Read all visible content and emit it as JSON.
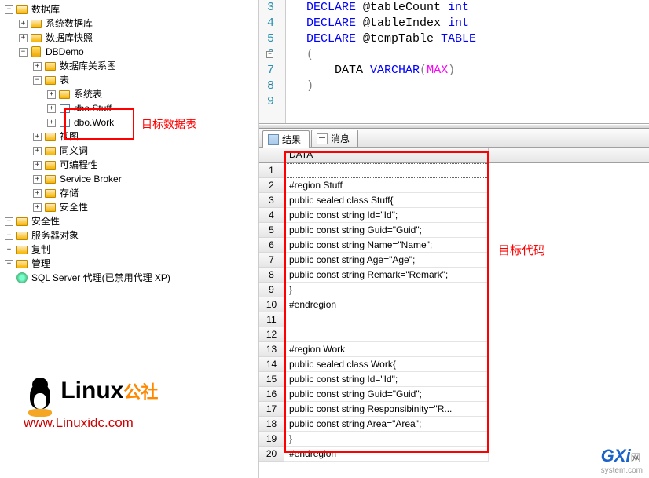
{
  "tree": {
    "root": "数据库",
    "sys_db": "系统数据库",
    "db_snapshot": "数据库快照",
    "dbdemo": "DBDemo",
    "db_diagram": "数据库关系图",
    "tables": "表",
    "sys_tables": "系统表",
    "dbo_stuff": "dbo.Stuff",
    "dbo_work": "dbo.Work",
    "views": "视图",
    "synonyms": "同义词",
    "programmability": "可编程性",
    "service_broker": "Service Broker",
    "storage": "存储",
    "security_inner": "安全性",
    "security": "安全性",
    "server_objects": "服务器对象",
    "replication": "复制",
    "management": "管理",
    "sql_agent": "SQL Server 代理(已禁用代理 XP)"
  },
  "callouts": {
    "target_table": "目标数据表",
    "target_code": "目标代码"
  },
  "logo": {
    "brand_main": "Linu",
    "brand_suffix": "x",
    "brand_cn": "公社",
    "url": "www.Linuxidc.com"
  },
  "editor": {
    "gutter": [
      "3",
      "4",
      "5",
      "6",
      "7",
      "8",
      "9"
    ],
    "lines": [
      {
        "kw": "DECLARE",
        "var": " @tableCount ",
        "type": "int"
      },
      {
        "kw": "DECLARE",
        "var": " @tableIndex ",
        "type": "int"
      },
      {
        "kw": "DECLARE",
        "var": " @tempTable ",
        "type": "TABLE"
      },
      {
        "plain": "("
      },
      {
        "indent": true,
        "var": "DATA ",
        "kw2": "VARCHAR",
        "paren_open": "(",
        "func": "MAX",
        "paren_close": ")"
      },
      {
        "plain": ")"
      },
      {
        "plain": ""
      }
    ]
  },
  "tabs": {
    "results": "结果",
    "messages": "消息"
  },
  "grid": {
    "header": "DATA",
    "rows": [
      "",
      "#region Stuff",
      "public sealed class Stuff{",
      "public const string Id=\"Id\";",
      "public const string Guid=\"Guid\";",
      "public const string Name=\"Name\";",
      "public const string Age=\"Age\";",
      "public const string Remark=\"Remark\";",
      "}",
      "#endregion",
      "",
      "",
      "#region Work",
      "public sealed class Work{",
      "public const string Id=\"Id\";",
      "public const string Guid=\"Guid\";",
      "public const string Responsibinity=\"R...",
      "public const string Area=\"Area\";",
      "}",
      "#endregion"
    ]
  },
  "gxi": {
    "main": "GXi",
    "wang": "网",
    "sub": "system.com"
  }
}
